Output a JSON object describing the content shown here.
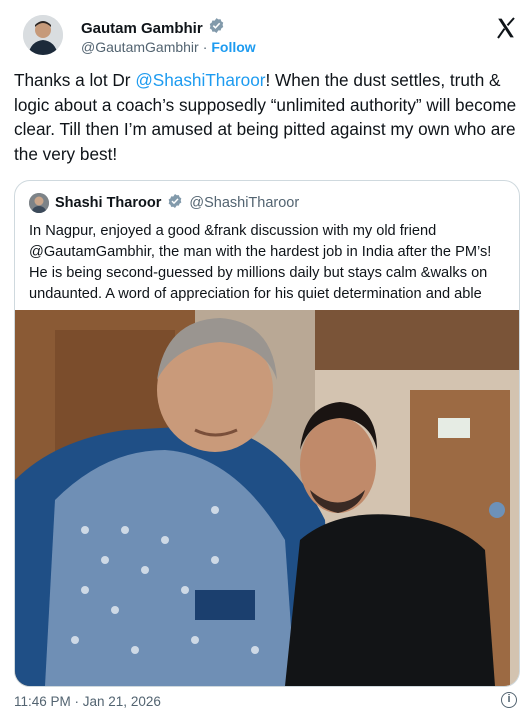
{
  "author": {
    "name": "Gautam Gambhir",
    "handle": "@GautamGambhir",
    "dot": "·",
    "follow_label": "Follow",
    "verified_icon": "verified-badge-icon"
  },
  "tweet": {
    "text_before": "Thanks a lot Dr ",
    "mention": "@ShashiTharoor",
    "text_after": "! When the dust settles, truth & logic about a coach’s supposedly “unlimited authority” will become clear. Till then I’m amused at being pitted against my own who are the very best!"
  },
  "quoted": {
    "name": "Shashi Tharoor",
    "handle": "@ShashiTharoor",
    "text": "In Nagpur, enjoyed a good &frank discussion with my old friend @GautamGambhir, the man with the hardest job in India after the PM’s! He is being second-guessed by millions daily but stays calm &walks on undaunted. A word of appreciation for his quiet determination and able",
    "photo_icon": "selfie-photo"
  },
  "footer": {
    "timestamp": "11:46 PM · Jan 21, 2026",
    "info_icon": "info-icon"
  },
  "colors": {
    "link": "#1d9bf0",
    "verified": "#829aab",
    "secondary_text": "#536471",
    "border": "#cfd9de"
  }
}
